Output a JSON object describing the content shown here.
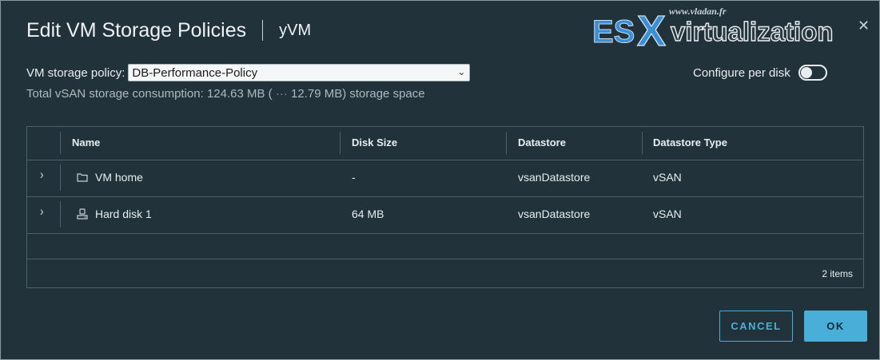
{
  "dialog": {
    "title": "Edit VM Storage Policies",
    "subtitle": "yVM"
  },
  "watermark": {
    "url_text": "www.vladan.fr",
    "brand_es": "ES",
    "brand_x": "X",
    "brand_rest": "virtualization"
  },
  "policy": {
    "label": "VM storage policy:",
    "selected": "DB-Performance-Policy"
  },
  "consumption": {
    "prefix": "Total vSAN storage consumption: 124.63 MB (",
    "dots": "···",
    "suffix": "12.79 MB) storage space"
  },
  "per_disk": {
    "label": "Configure per disk",
    "enabled": false
  },
  "table": {
    "columns": [
      "Name",
      "Disk Size",
      "Datastore",
      "Datastore Type"
    ],
    "rows": [
      {
        "name": "VM home",
        "icon": "folder-icon",
        "disk_size": "-",
        "datastore": "vsanDatastore",
        "type": "vSAN"
      },
      {
        "name": "Hard disk 1",
        "icon": "hard-disk-icon",
        "disk_size": "64 MB",
        "datastore": "vsanDatastore",
        "type": "vSAN"
      }
    ],
    "footer": "2 items"
  },
  "buttons": {
    "cancel": "CANCEL",
    "ok": "OK"
  },
  "colors": {
    "background": "#22323a",
    "accent": "#49afd9",
    "watermark_blue": "#3a8fd6"
  }
}
